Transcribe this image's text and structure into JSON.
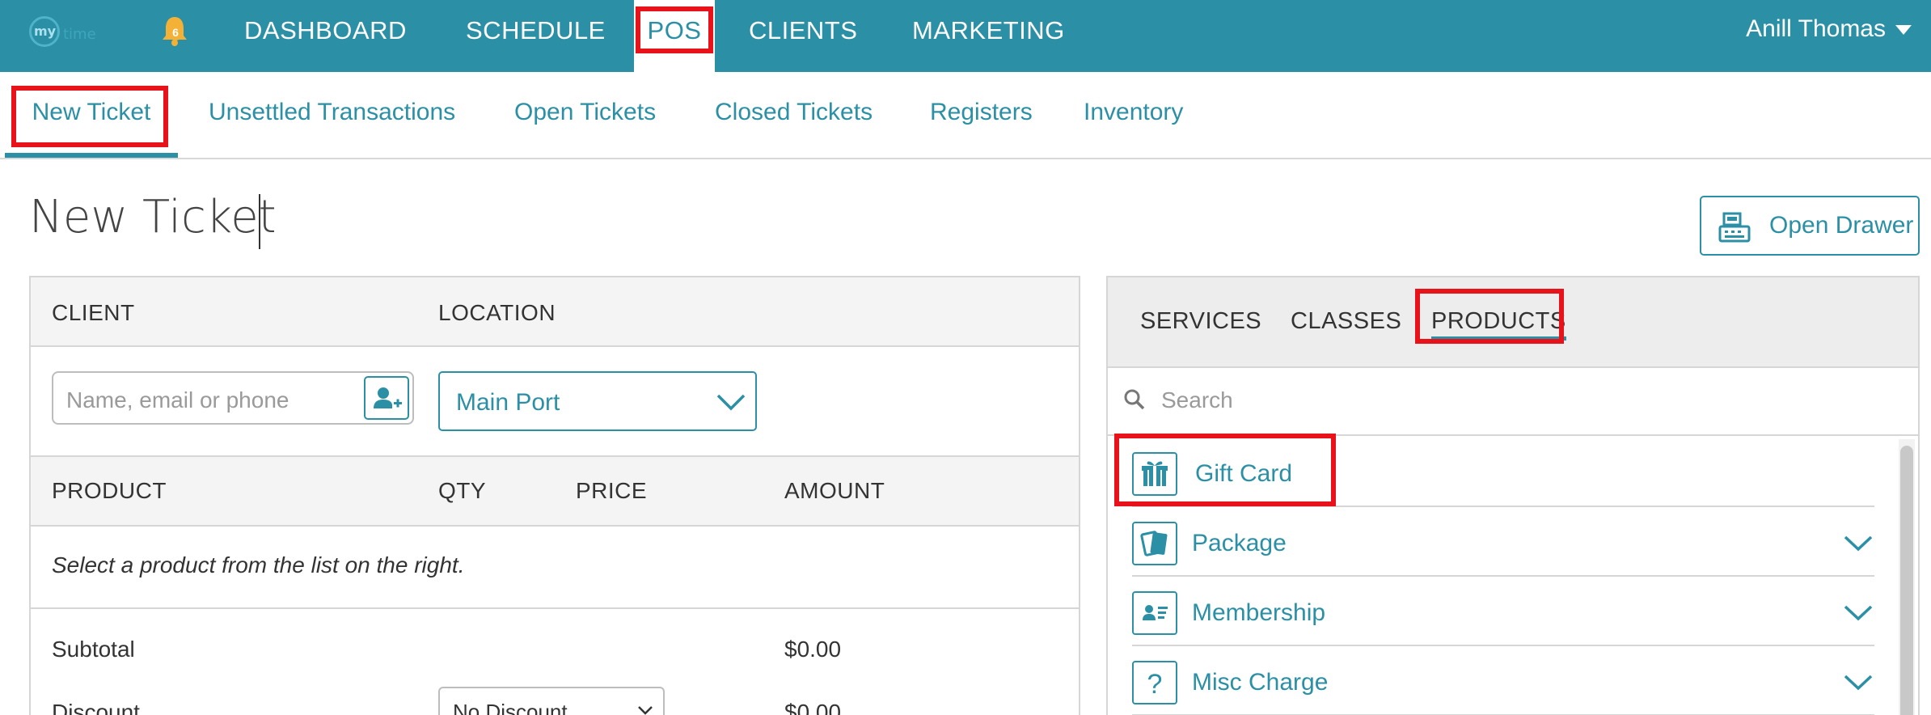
{
  "topnav": {
    "logo_text": "my time",
    "notification_count": "6",
    "items": [
      {
        "label": "DASHBOARD"
      },
      {
        "label": "SCHEDULE"
      },
      {
        "label": "POS"
      },
      {
        "label": "CLIENTS"
      },
      {
        "label": "MARKETING"
      }
    ],
    "active_item": "POS",
    "user_name": "Anill Thomas"
  },
  "subnav": {
    "tabs": [
      {
        "label": "New Ticket"
      },
      {
        "label": "Unsettled Transactions"
      },
      {
        "label": "Open Tickets"
      },
      {
        "label": "Closed Tickets"
      },
      {
        "label": "Registers"
      },
      {
        "label": "Inventory"
      }
    ],
    "active_tab": "New Ticket"
  },
  "page": {
    "title": "New Ticket",
    "open_drawer_label": "Open Drawer"
  },
  "ticket": {
    "client_header": "CLIENT",
    "location_header": "LOCATION",
    "client_placeholder": "Name, email or phone",
    "location_value": "Main Port",
    "columns": [
      "PRODUCT",
      "QTY",
      "PRICE",
      "AMOUNT"
    ],
    "empty_message": "Select a product from the list on the right.",
    "subtotal_label": "Subtotal",
    "subtotal_value": "$0.00",
    "discount_label": "Discount",
    "discount_select": "No Discount",
    "discount_value": "$0.00"
  },
  "catalog": {
    "tabs": [
      {
        "label": "SERVICES"
      },
      {
        "label": "CLASSES"
      },
      {
        "label": "PRODUCTS"
      }
    ],
    "active_tab": "PRODUCTS",
    "search_placeholder": "Search",
    "items": [
      {
        "label": "Gift Card",
        "icon": "gift-icon"
      },
      {
        "label": "Package",
        "icon": "package-cards-icon"
      },
      {
        "label": "Membership",
        "icon": "membership-card-icon"
      },
      {
        "label": "Misc Charge",
        "icon": "question-mark-icon"
      }
    ]
  },
  "colors": {
    "primary": "#2b8fa5",
    "highlight": "#e8121b",
    "notification": "#f3b237"
  }
}
